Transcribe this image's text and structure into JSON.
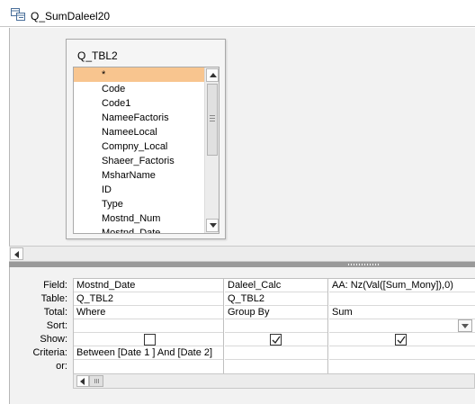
{
  "window": {
    "title": "Q_SumDaleel20",
    "icon": "query-icon"
  },
  "table_box": {
    "name": "Q_TBL2",
    "fields": [
      "*",
      "Code",
      "Code1",
      "NameeFactoris",
      "NameeLocal",
      "Compny_Local",
      "Shaeer_Factoris",
      "MsharName",
      "ID",
      "Type",
      "Mostnd_Num",
      "Mostnd_Date"
    ],
    "selected_index": 0
  },
  "grid": {
    "row_labels": [
      "Field:",
      "Table:",
      "Total:",
      "Sort:",
      "Show:",
      "Criteria:",
      "or:"
    ],
    "columns": [
      {
        "field": "Mostnd_Date",
        "table": "Q_TBL2",
        "total": "Where",
        "sort": "",
        "show": false,
        "criteria": "Between [Date 1 ] And [Date 2]",
        "or": ""
      },
      {
        "field": "Daleel_Calc",
        "table": "Q_TBL2",
        "total": "Group By",
        "sort": "",
        "show": true,
        "criteria": "",
        "or": ""
      },
      {
        "field": "AA: Nz(Val([Sum_Mony]),0)",
        "table": "",
        "total": "Sum",
        "sort": "",
        "show": true,
        "criteria": "",
        "or": ""
      }
    ]
  },
  "colors": {
    "selected_row": "#f8c58f",
    "splitter": "#999999",
    "pane_bg": "#f2f2f2"
  }
}
